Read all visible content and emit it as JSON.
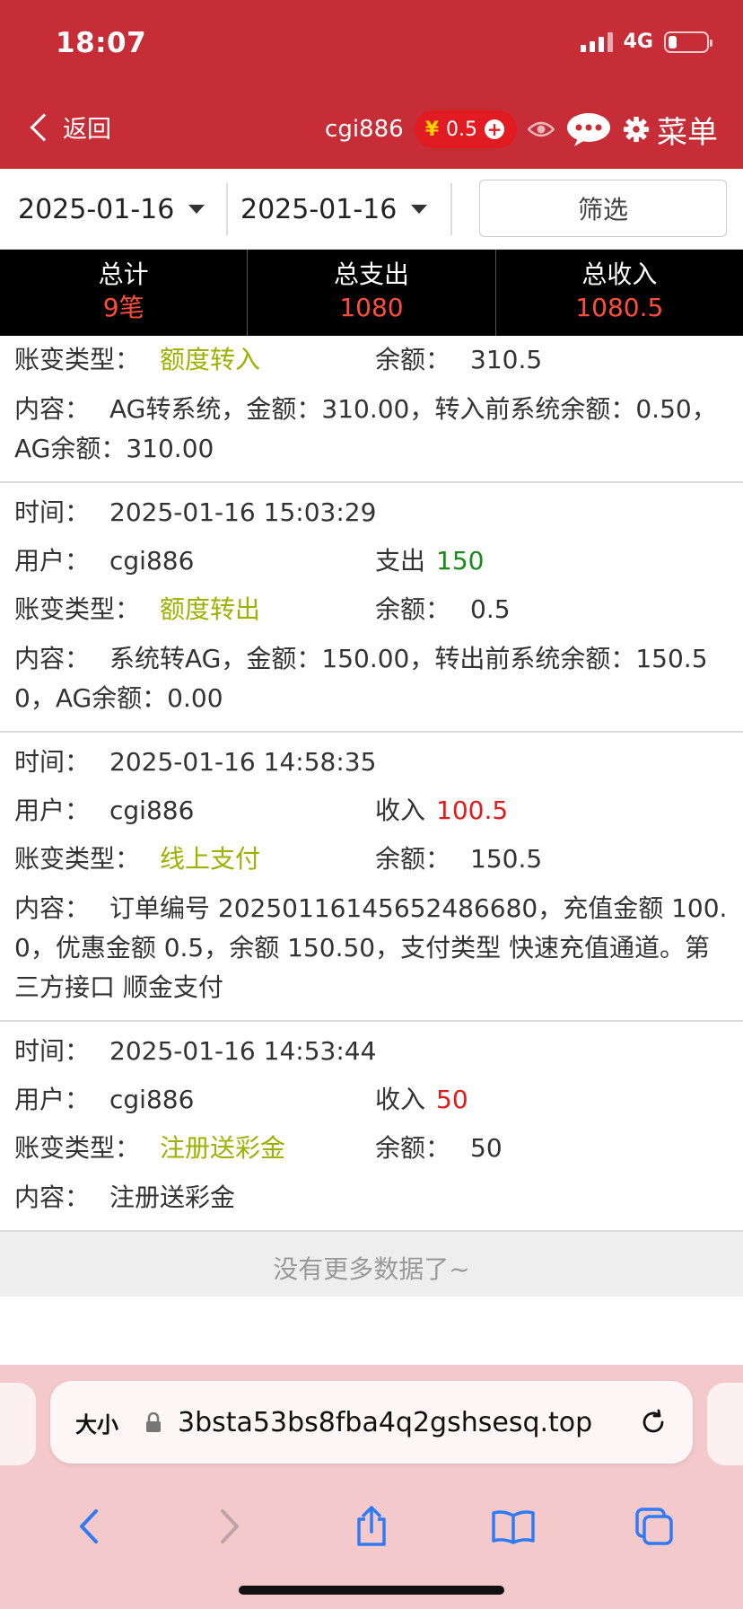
{
  "status_bar": {
    "time": "18:07",
    "network": "4G"
  },
  "header": {
    "back_label": "返回",
    "username": "cgi886",
    "currency_symbol": "¥",
    "balance": "0.5",
    "menu_label": "菜单"
  },
  "filter": {
    "start_date": "2025-01-16",
    "end_date": "2025-01-16",
    "filter_label": "筛选"
  },
  "summary": [
    {
      "label": "总计",
      "value": "9笔"
    },
    {
      "label": "总支出",
      "value": "1080"
    },
    {
      "label": "总收入",
      "value": "1080.5"
    }
  ],
  "labels": {
    "time": "时间：",
    "user": "用户：",
    "type": "账变类型：",
    "balance": "余额：",
    "content": "内容："
  },
  "records": [
    {
      "type": "额度转入",
      "balance": "310.5",
      "content": "AG转系统，金额：310.00，转入前系统余额：0.50，AG余额：310.00"
    },
    {
      "time": "2025-01-16 15:03:29",
      "user": "cgi886",
      "direction": "支出",
      "amount": "150",
      "type": "额度转出",
      "balance": "0.5",
      "content": "系统转AG，金额：150.00，转出前系统余额：150.50，AG余额：0.00"
    },
    {
      "time": "2025-01-16 14:58:35",
      "user": "cgi886",
      "direction": "收入",
      "amount": "100.5",
      "type": "线上支付",
      "balance": "150.5",
      "content": "订单编号 20250116145652486680，充值金额 100.0，优惠金额 0.5，余额 150.50，支付类型 快速充值通道。第三方接口 顺金支付"
    },
    {
      "time": "2025-01-16 14:53:44",
      "user": "cgi886",
      "direction": "收入",
      "amount": "50",
      "type": "注册送彩金",
      "balance": "50",
      "content": "注册送彩金"
    }
  ],
  "no_more": "没有更多数据了~",
  "browser": {
    "text_size_label": "大小",
    "url": "3bsta53bs8fba4q2gshsesq.top"
  }
}
